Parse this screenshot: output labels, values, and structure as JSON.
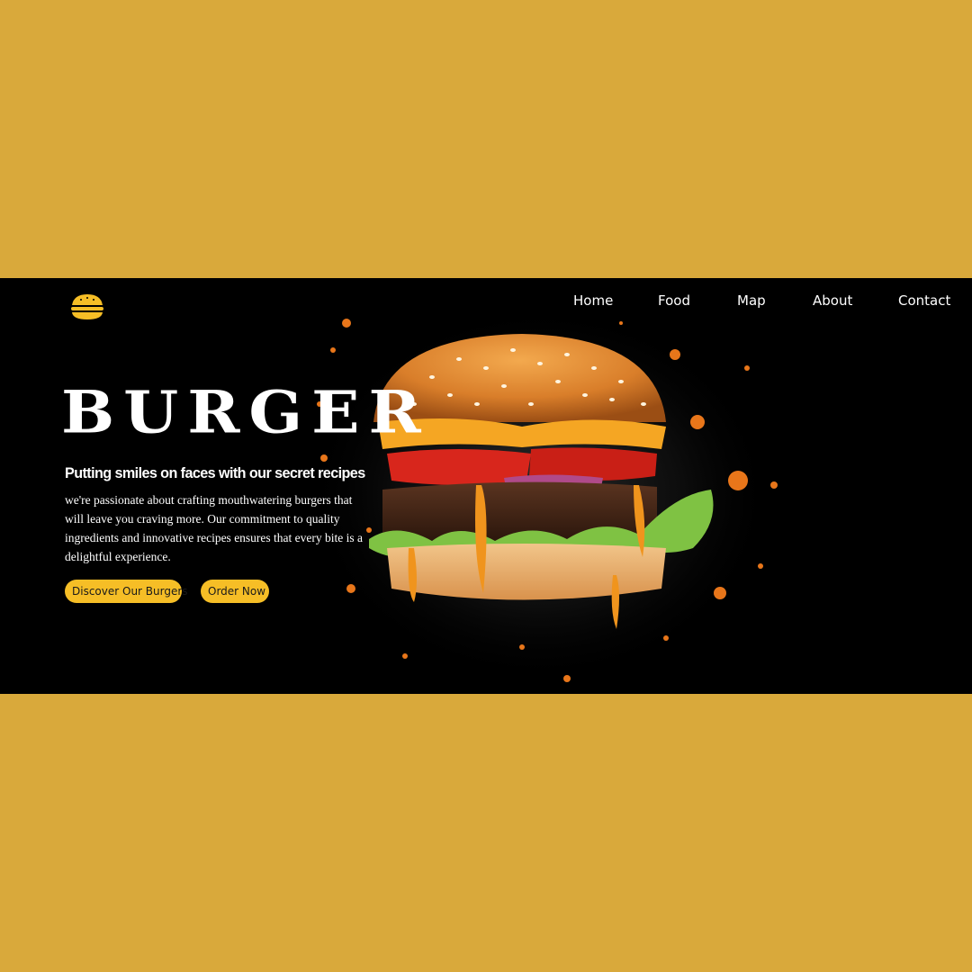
{
  "nav": {
    "items": [
      {
        "label": "Home"
      },
      {
        "label": "Food"
      },
      {
        "label": "Map"
      },
      {
        "label": "About"
      },
      {
        "label": "Contact"
      }
    ]
  },
  "hero": {
    "title": "BURGER",
    "subtitle": "Putting smiles on faces with our secret recipes",
    "description": "we're passionate about crafting mouthwatering burgers that will leave you craving more. Our commitment to quality ingredients and innovative recipes ensures that every bite is a delightful experience.",
    "buttons": {
      "discover_label": "Discover Our Burgers",
      "order_label": "Order Now"
    }
  },
  "colors": {
    "page_background": "#D9A93B",
    "hero_background": "#000000",
    "accent": "#F6BE26",
    "text": "#FFFFFF"
  },
  "icons": {
    "logo": "burger-icon",
    "hero_image": "burger-photo"
  }
}
